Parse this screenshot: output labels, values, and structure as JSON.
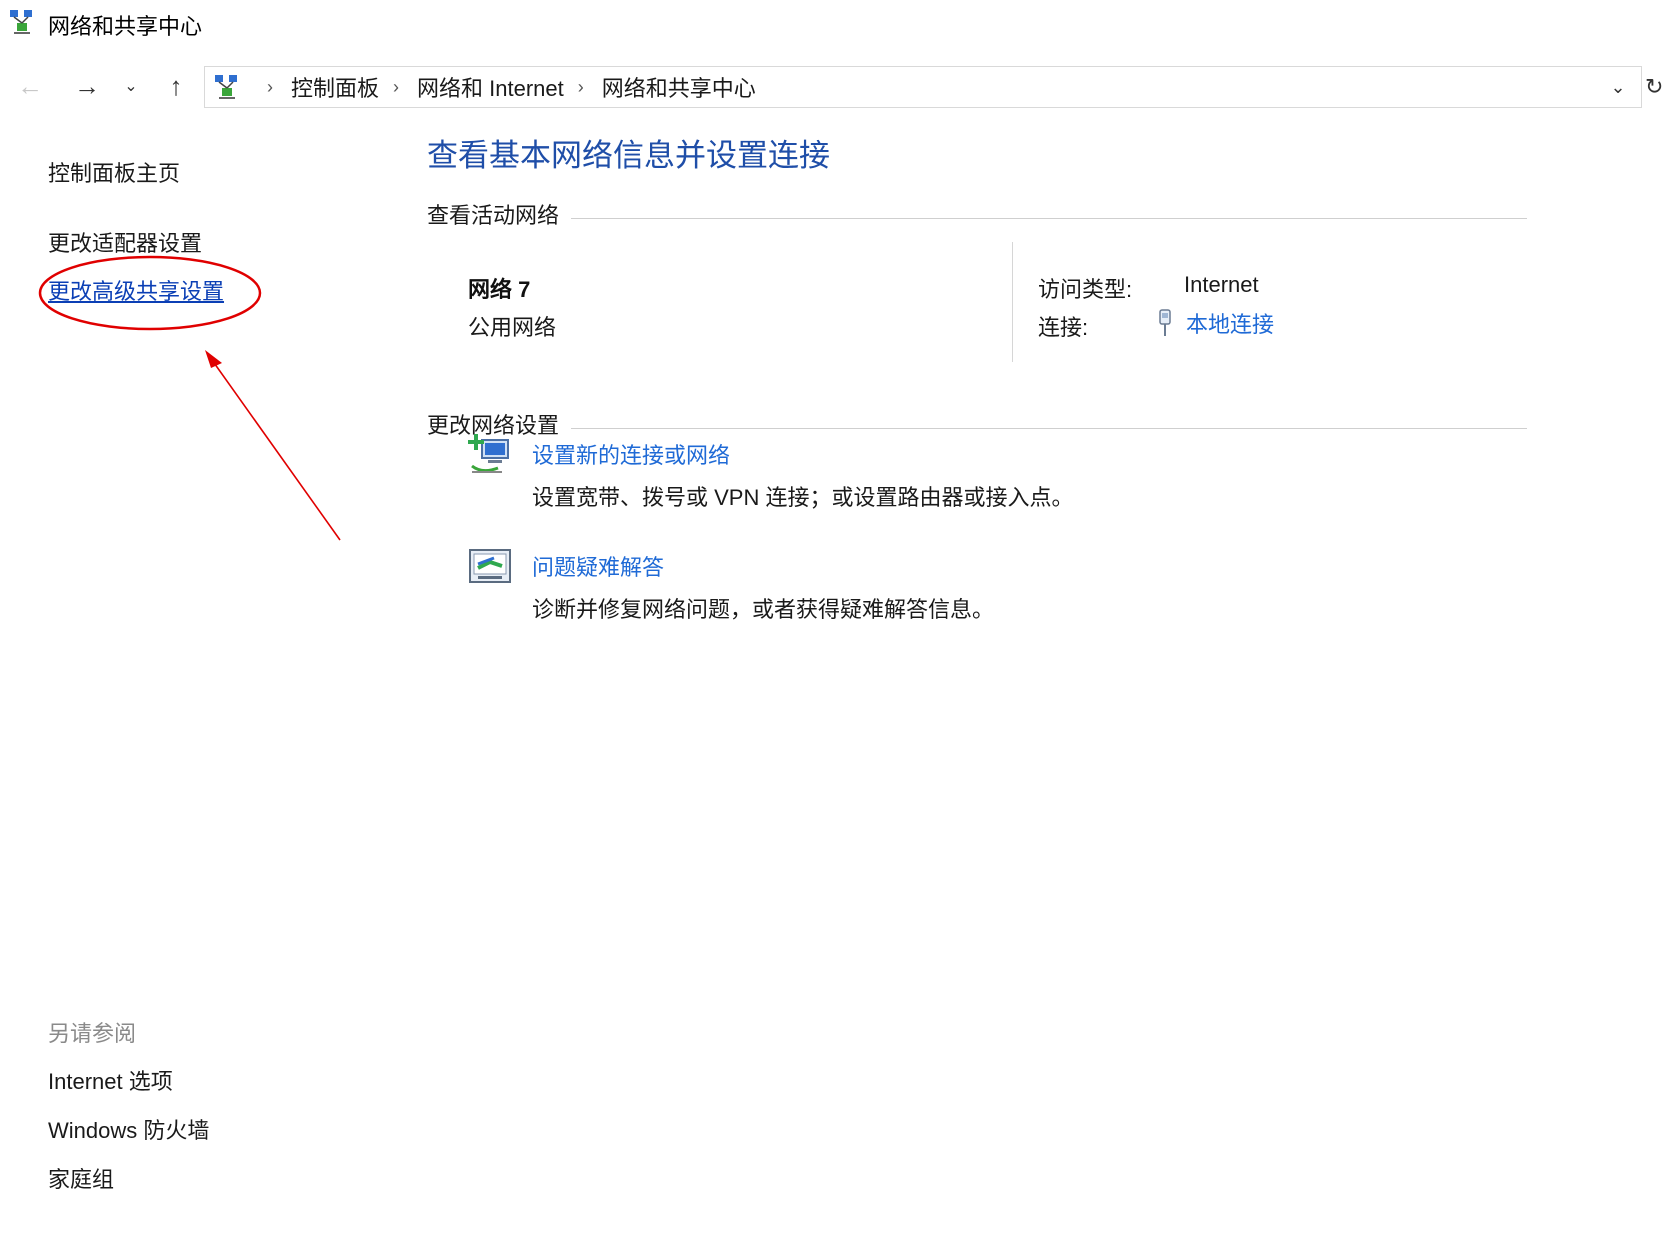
{
  "window": {
    "title": "网络和共享中心"
  },
  "nav": {
    "back": "←",
    "forward": "→",
    "recent": "⌄",
    "up": "↑",
    "refresh": "↻",
    "dropdown": "⌄"
  },
  "address": {
    "breadcrumbs": [
      "控制面板",
      "网络和 Internet",
      "网络和共享中心"
    ],
    "separator": "›"
  },
  "left": {
    "home": "控制面板主页",
    "adapter": "更改适配器设置",
    "advanced_sharing": "更改高级共享设置",
    "see_also_title": "另请参阅",
    "see_also": [
      "Internet 选项",
      "Windows 防火墙",
      "家庭组"
    ]
  },
  "main": {
    "title": "查看基本网络信息并设置连接",
    "active_networks_header": "查看活动网络",
    "network": {
      "name": "网络  7",
      "category": "公用网络",
      "access_type_label": "访问类型:",
      "access_type_value": "Internet",
      "connections_label": "连接:",
      "connection_name": "本地连接"
    },
    "change_settings_header": "更改网络设置",
    "tasks": [
      {
        "icon": "new-connection-icon",
        "title": "设置新的连接或网络",
        "description": "设置宽带、拨号或 VPN 连接；或设置路由器或接入点。"
      },
      {
        "icon": "troubleshoot-icon",
        "title": "问题疑难解答",
        "description": "诊断并修复网络问题，或者获得疑难解答信息。"
      }
    ]
  },
  "annotation": {
    "color": "#e00000",
    "target": "更改高级共享设置"
  }
}
